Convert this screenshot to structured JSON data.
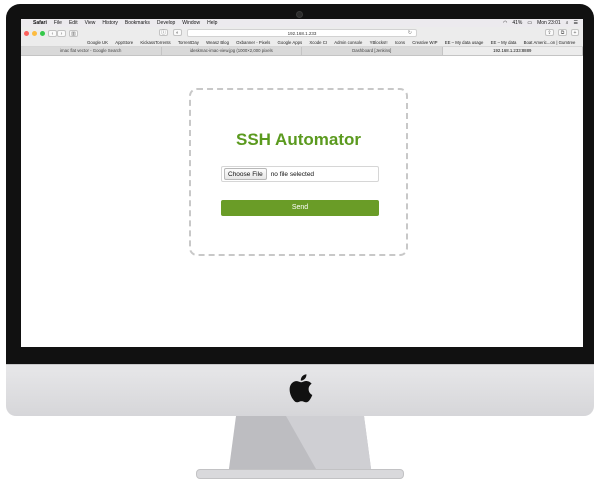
{
  "menubar": {
    "app": "Safari",
    "items": [
      "File",
      "Edit",
      "View",
      "History",
      "Bookmarks",
      "Develop",
      "Window",
      "Help"
    ],
    "battery": "41%",
    "clock": "Mon 23:01"
  },
  "browser": {
    "url": "192.168.1.233",
    "bookmarks": [
      "Google UK",
      "AppStore",
      "KickassTorrents",
      "TorrentDay",
      "Weasz Blog",
      "Oxbanner - Pixels",
      "Google Apps",
      "Xcode CI",
      "Admin console",
      "YBlocks!!",
      "Icons",
      "Creative WIP",
      "EE – My data usage",
      "EE – My data",
      "Boat Americ...on | Gumtree"
    ],
    "tabs": [
      {
        "label": "imac flat vector - Google Search",
        "active": false
      },
      {
        "label": "ideskmac-imac-view.jpg (1000×2,000 pixels",
        "active": false
      },
      {
        "label": "Dashboard [Jenkins]",
        "active": false
      },
      {
        "label": "192.168.1.233:8889",
        "active": true
      }
    ]
  },
  "page": {
    "title": "SSH Automator",
    "file_button": "Choose File",
    "file_status": "no file selected",
    "send_label": "Send"
  },
  "colors": {
    "accent": "#6a9c27",
    "title": "#5b9a1f"
  }
}
